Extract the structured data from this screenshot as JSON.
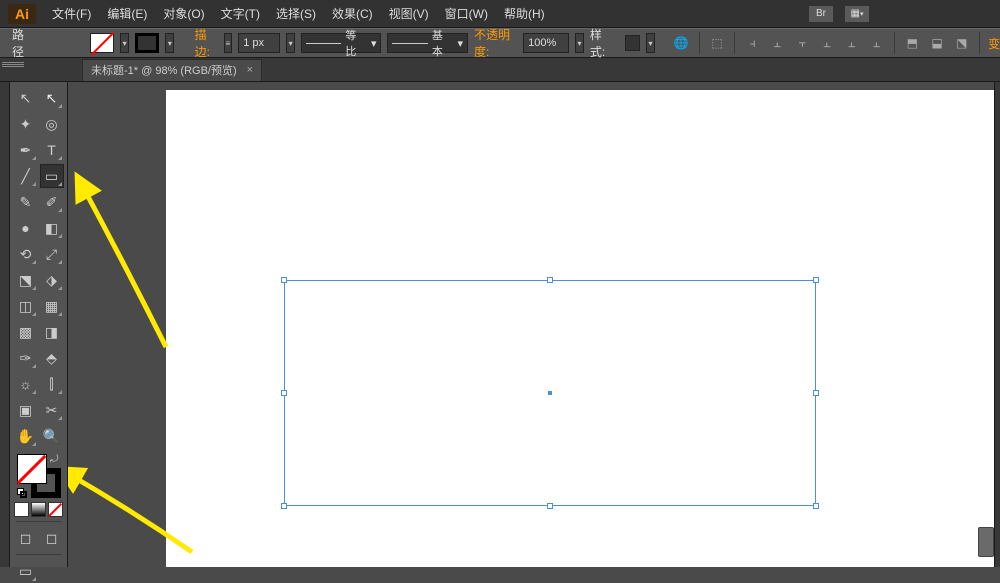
{
  "app": {
    "logo": "Ai"
  },
  "menu": {
    "file": "文件(F)",
    "edit": "编辑(E)",
    "object": "对象(O)",
    "type": "文字(T)",
    "select": "选择(S)",
    "effect": "效果(C)",
    "view": "视图(V)",
    "window": "窗口(W)",
    "help": "帮助(H)"
  },
  "topbuttons": {
    "br": "Br"
  },
  "control": {
    "path_label": "路径",
    "stroke_label": "描边:",
    "stroke_width": "1 px",
    "uniform_label": "等比",
    "basic_label": "基本",
    "opacity_label": "不透明度:",
    "opacity_value": "100%",
    "style_label": "样式:",
    "transform_char": "变"
  },
  "tab": {
    "title": "未标题-1* @ 98% (RGB/预览)",
    "close": "×"
  },
  "ctrl_arrows": {
    "down": "▾",
    "dd": "▼"
  },
  "tools": {
    "selection": "↖",
    "direct": "↖",
    "wand": "✦",
    "lasso": "◎",
    "pen": "✒",
    "type": "T",
    "line": "╱",
    "rect": "▭",
    "brush": "✎",
    "pencil": "✐",
    "blob": "●",
    "eraser": "◧",
    "rotate": "⟲",
    "scale": "⤢",
    "width": "⬔",
    "warp": "⬗",
    "shapebuilder": "◫",
    "perspective": "▦",
    "mesh": "▩",
    "gradient": "◨",
    "eyedrop": "✑",
    "blend": "⬘",
    "symbol": "☼",
    "graph": "⫿",
    "artboard": "▣",
    "slice": "✂",
    "hand": "✋",
    "zoom": "🔍",
    "drawnormal": "◻",
    "drawbehind": "◻",
    "drawinside": "◻",
    "screen": "▭"
  },
  "align": {
    "globe": "🌐",
    "doc": "⬚",
    "l": "⫞",
    "c": "⫠",
    "r": "⫟",
    "t": "⫠",
    "m": "⫠",
    "b": "⫠",
    "dl": "⬒",
    "dc": "⬓",
    "dr": "⬔"
  }
}
